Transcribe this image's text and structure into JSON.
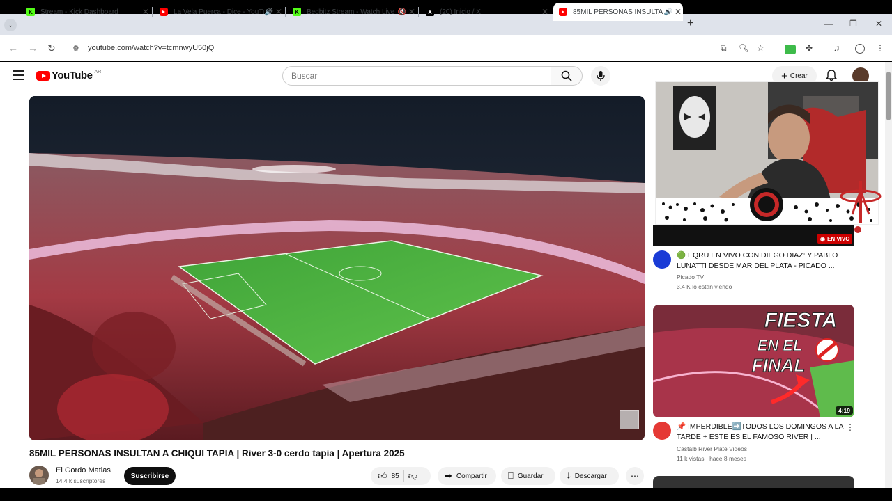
{
  "browser": {
    "tabs": [
      {
        "title": "Stream - Kick Dashboard",
        "favicon": "kick-icon"
      },
      {
        "title": "La Vela Puerca - Dice - YouTu",
        "favicon": "youtube-icon",
        "audio": true
      },
      {
        "title": "Bedbitz Stream - Watch Live",
        "favicon": "kick-icon",
        "muted": true
      },
      {
        "title": "(20) Inicio / X",
        "favicon": "x-icon"
      },
      {
        "title": "85MIL PERSONAS INSULTAN",
        "favicon": "youtube-icon",
        "audio": true,
        "active": true
      }
    ],
    "url": "youtube.com/watch?v=tcmnwyU50jQ"
  },
  "youtube": {
    "logo_text": "YouTube",
    "country_code": "AR",
    "search_placeholder": "Buscar",
    "create_label": "Crear"
  },
  "video": {
    "title": "85MIL PERSONAS INSULTAN A CHIQUI TAPIA | River 3-0 cerdo tapia | Apertura 2025",
    "channel": "El Gordo Matias",
    "subscribers": "14.4 k suscriptores",
    "subscribe_label": "Suscribirse",
    "likes": "85",
    "share_label": "Compartir",
    "save_label": "Guardar",
    "download_label": "Descargar"
  },
  "recommendations": [
    {
      "badge": "EN VIVO",
      "title": "🟢 EQRU EN VIVO CON DIEGO DIAZ: Y PABLO LUNATTI DESDE MAR DEL PLATA  - PICADO ...",
      "channel": "Picado TV",
      "meta": "3.4 K lo están viendo"
    },
    {
      "thumb_text_1": "FIESTA",
      "thumb_text_2": "EN EL",
      "thumb_text_3": "FINAL",
      "duration": "4:19",
      "title": "📌 IMPERDIBLE➡️TODOS LOS DOMINGOS A LA TARDE + ESTE ES EL FAMOSO RIVER | ...",
      "channel": "Castalb River Plate Videos",
      "meta": "11 k vistas · hace 8 meses"
    }
  ],
  "colors": {
    "yt_red": "#ff0000",
    "live_red": "#cc0000",
    "pitch_green": "#4fb040"
  }
}
